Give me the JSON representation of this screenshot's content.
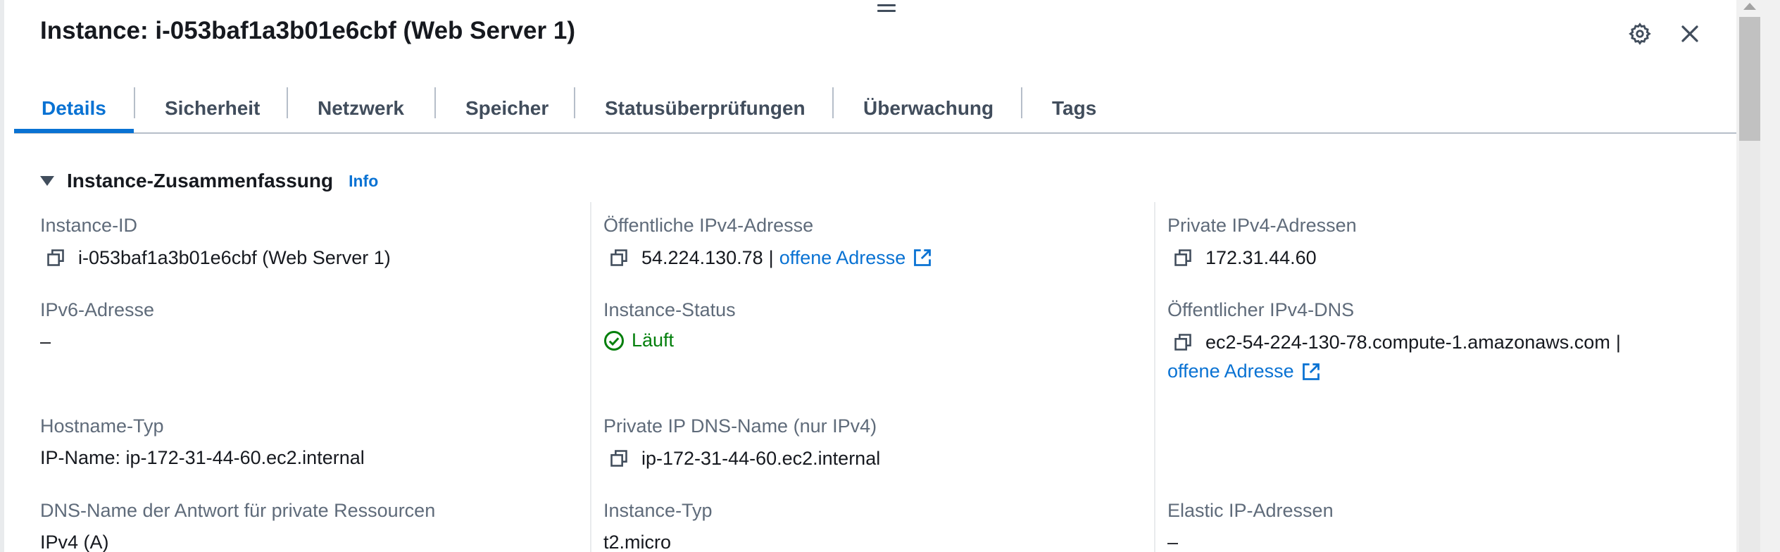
{
  "header": {
    "title": "Instance: i-053baf1a3b01e6cbf (Web Server 1)",
    "settings_icon": "gear-icon",
    "close_icon": "close-icon"
  },
  "tabs": [
    {
      "label": "Details",
      "active": true
    },
    {
      "label": "Sicherheit"
    },
    {
      "label": "Netzwerk"
    },
    {
      "label": "Speicher"
    },
    {
      "label": "Statusüberprüfungen"
    },
    {
      "label": "Überwachung"
    },
    {
      "label": "Tags"
    }
  ],
  "section": {
    "title": "Instance-Zusammenfassung",
    "info_label": "Info"
  },
  "fields": {
    "instance_id": {
      "label": "Instance-ID",
      "value": "i-053baf1a3b01e6cbf (Web Server 1)"
    },
    "public_ipv4": {
      "label": "Öffentliche IPv4-Adresse",
      "value": "54.224.130.78",
      "separator": "|",
      "link": "offene Adresse"
    },
    "private_ipv4": {
      "label": "Private IPv4-Adressen",
      "value": "172.31.44.60"
    },
    "ipv6": {
      "label": "IPv6-Adresse",
      "value": "–"
    },
    "instance_status": {
      "label": "Instance-Status",
      "value": "Läuft"
    },
    "public_dns": {
      "label": "Öffentlicher IPv4-DNS",
      "value": "ec2-54-224-130-78.compute-1.amazonaws.com",
      "separator": "|",
      "link": "offene Adresse"
    },
    "hostname_type": {
      "label": "Hostname-Typ",
      "value": "IP-Name: ip-172-31-44-60.ec2.internal"
    },
    "private_dns": {
      "label": "Private IP DNS-Name (nur IPv4)",
      "value": "ip-172-31-44-60.ec2.internal"
    },
    "dns_answer": {
      "label": "DNS-Name der Antwort für private Ressourcen",
      "value": "IPv4 (A)"
    },
    "instance_type": {
      "label": "Instance-Typ",
      "value": "t2.micro"
    },
    "elastic_ip": {
      "label": "Elastic IP-Adressen",
      "value": "–"
    }
  },
  "colors": {
    "accent": "#0972d3",
    "success": "#037f0c",
    "label": "#5f6b7a",
    "text": "#16191f"
  }
}
